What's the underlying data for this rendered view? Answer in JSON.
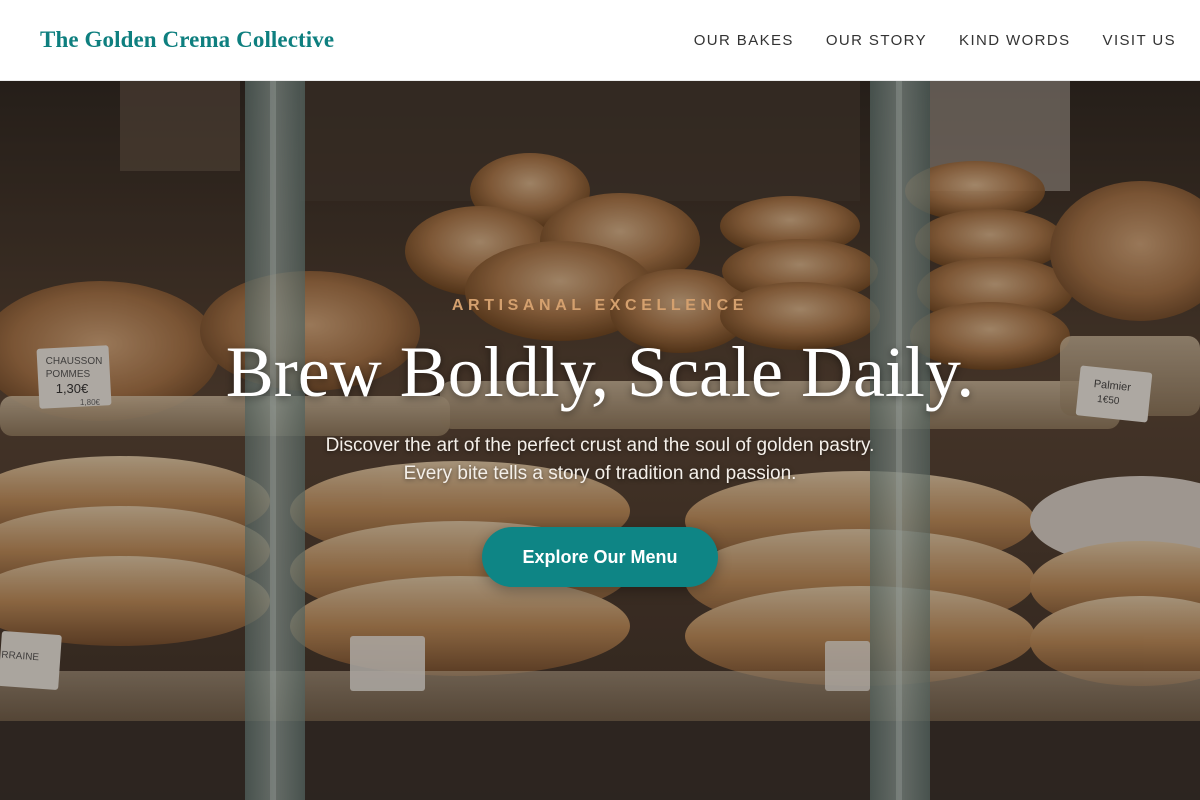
{
  "header": {
    "brand": "The Golden Crema Collective",
    "nav": [
      {
        "label": "OUR BAKES"
      },
      {
        "label": "OUR STORY"
      },
      {
        "label": "KIND WORDS"
      },
      {
        "label": "VISIT US"
      }
    ]
  },
  "hero": {
    "eyebrow": "ARTISANAL EXCELLENCE",
    "headline": "Brew Boldly, Scale Daily.",
    "subtext_line1": "Discover the art of the perfect crust and the soul of golden pastry.",
    "subtext_line2": "Every bite tells a story of tradition and passion.",
    "cta_label": "Explore Our Menu",
    "image_labels": {
      "tag_left_line1": "CHAUSSON",
      "tag_left_line2": "POMMES",
      "tag_left_price": "1,30€",
      "tag_left_small": "1,80€",
      "tag_right_line1": "Palmier",
      "tag_right_price": "1€50",
      "tag_bottom_left": "RRAINE"
    }
  },
  "colors": {
    "brand": "#0e7f7f",
    "accent_eyebrow": "#d4a06e",
    "cta_background": "#0e8585",
    "nav_text": "#333333"
  }
}
